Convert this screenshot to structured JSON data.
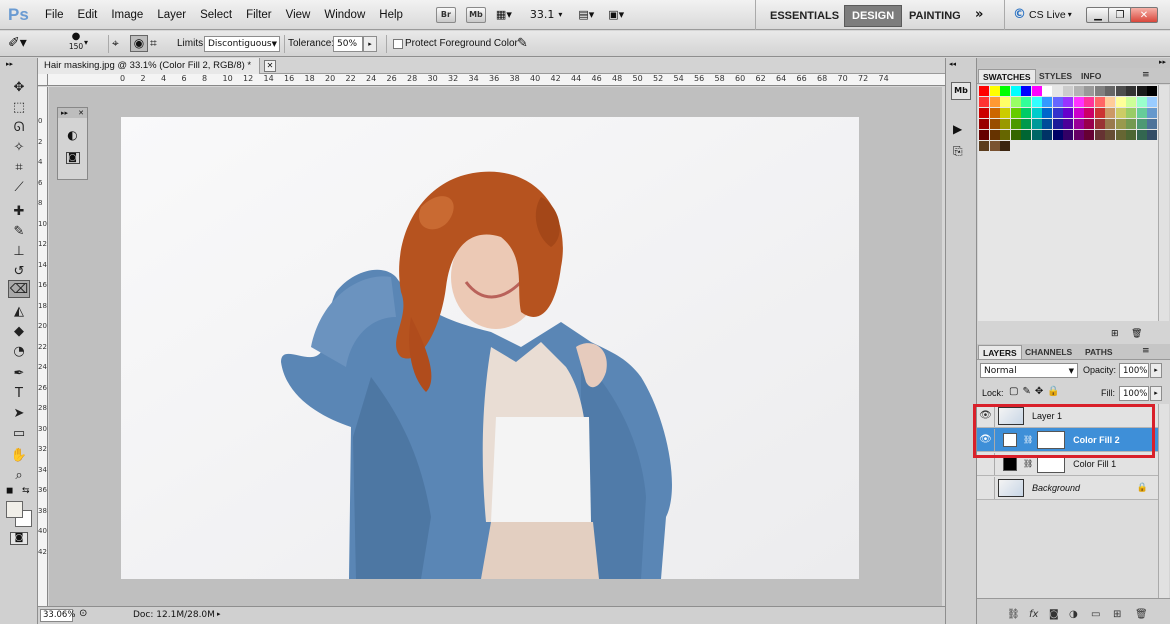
{
  "app": {
    "logo": "Ps"
  },
  "menu": [
    "File",
    "Edit",
    "Image",
    "Layer",
    "Select",
    "Filter",
    "View",
    "Window",
    "Help"
  ],
  "topbar": {
    "bridge": "Br",
    "minibridge": "Mb",
    "zoom_value": "33.1",
    "workspaces": [
      "ESSENTIALS",
      "DESIGN",
      "PAINTING"
    ],
    "active_workspace": "DESIGN",
    "more": "»",
    "cslive": "CS Live"
  },
  "options": {
    "brush_size": "150",
    "limits_label": "Limits:",
    "limits_value": "Discontiguous",
    "tolerance_label": "Tolerance:",
    "tolerance_value": "50%",
    "protect_label": "Protect Foreground Color"
  },
  "document": {
    "tab_title": "Hair masking.jpg @ 33.1% (Color Fill 2, RGB/8) *",
    "ruler_top": [
      "0",
      "2",
      "4",
      "6",
      "8",
      "10",
      "12",
      "14",
      "16",
      "18",
      "20",
      "22",
      "24",
      "26",
      "28",
      "30",
      "32",
      "34",
      "36",
      "38",
      "40",
      "42",
      "44",
      "46",
      "48",
      "50",
      "52",
      "54",
      "56",
      "58",
      "60",
      "62",
      "64",
      "66",
      "68",
      "70",
      "72",
      "74"
    ],
    "ruler_left": [
      "0",
      "2",
      "4",
      "6",
      "8",
      "10",
      "12",
      "14",
      "16",
      "18",
      "20",
      "22",
      "24",
      "26",
      "28",
      "30",
      "32",
      "34",
      "36",
      "38",
      "40",
      "42"
    ],
    "status_zoom": "33.06%",
    "status_doc": "Doc: 12.1M/28.0M"
  },
  "panels": {
    "swatch_tabs": [
      "SWATCHES",
      "STYLES",
      "INFO"
    ],
    "layer_tabs": [
      "LAYERS",
      "CHANNELS",
      "PATHS"
    ],
    "blend_mode": "Normal",
    "opacity_label": "Opacity:",
    "opacity_value": "100%",
    "lock_label": "Lock:",
    "fill_label": "Fill:",
    "fill_value": "100%",
    "layers": [
      {
        "name": "Layer 1",
        "visible": true,
        "selected": false
      },
      {
        "name": "Color Fill 2",
        "visible": true,
        "selected": true
      },
      {
        "name": "Color Fill 1",
        "visible": false,
        "selected": false
      },
      {
        "name": "Background",
        "visible": false,
        "selected": false
      }
    ],
    "highlight_color": "#d9202a",
    "selected_color": "#3e8fd8"
  },
  "swatch_colors": [
    "#ff0000",
    "#ffff00",
    "#00ff00",
    "#00ffff",
    "#0000ff",
    "#ff00ff",
    "#ffffff",
    "#e6e6e6",
    "#cccccc",
    "#b3b3b3",
    "#999999",
    "#808080",
    "#666666",
    "#4d4d4d",
    "#333333",
    "#1a1a1a",
    "#000000",
    "#ff3333",
    "#ff9933",
    "#ffff66",
    "#99ff66",
    "#33ff99",
    "#33ffff",
    "#3399ff",
    "#6666ff",
    "#9933ff",
    "#ff33ff",
    "#ff3399",
    "#ff6666",
    "#ffcc99",
    "#ffff99",
    "#ccff99",
    "#99ffcc",
    "#99ccff",
    "#cc0000",
    "#cc6600",
    "#cccc00",
    "#66cc00",
    "#00cc66",
    "#00cccc",
    "#0066cc",
    "#3333cc",
    "#6600cc",
    "#cc00cc",
    "#cc0066",
    "#cc3333",
    "#cc9966",
    "#cccc66",
    "#99cc66",
    "#66cc99",
    "#6699cc",
    "#990000",
    "#994c00",
    "#999900",
    "#4c9900",
    "#00994c",
    "#009999",
    "#004c99",
    "#1a1a99",
    "#4c0099",
    "#990099",
    "#99004c",
    "#993333",
    "#997a4d",
    "#99994d",
    "#739950",
    "#4d9973",
    "#4d7399",
    "#660000",
    "#663300",
    "#666600",
    "#336600",
    "#006633",
    "#006666",
    "#003366",
    "#000066",
    "#330066",
    "#660066",
    "#660033",
    "#663333",
    "#664d33",
    "#666633",
    "#4d6633",
    "#336650",
    "#334d66",
    "#5c3d1e",
    "#7a5230",
    "#3b2410"
  ]
}
